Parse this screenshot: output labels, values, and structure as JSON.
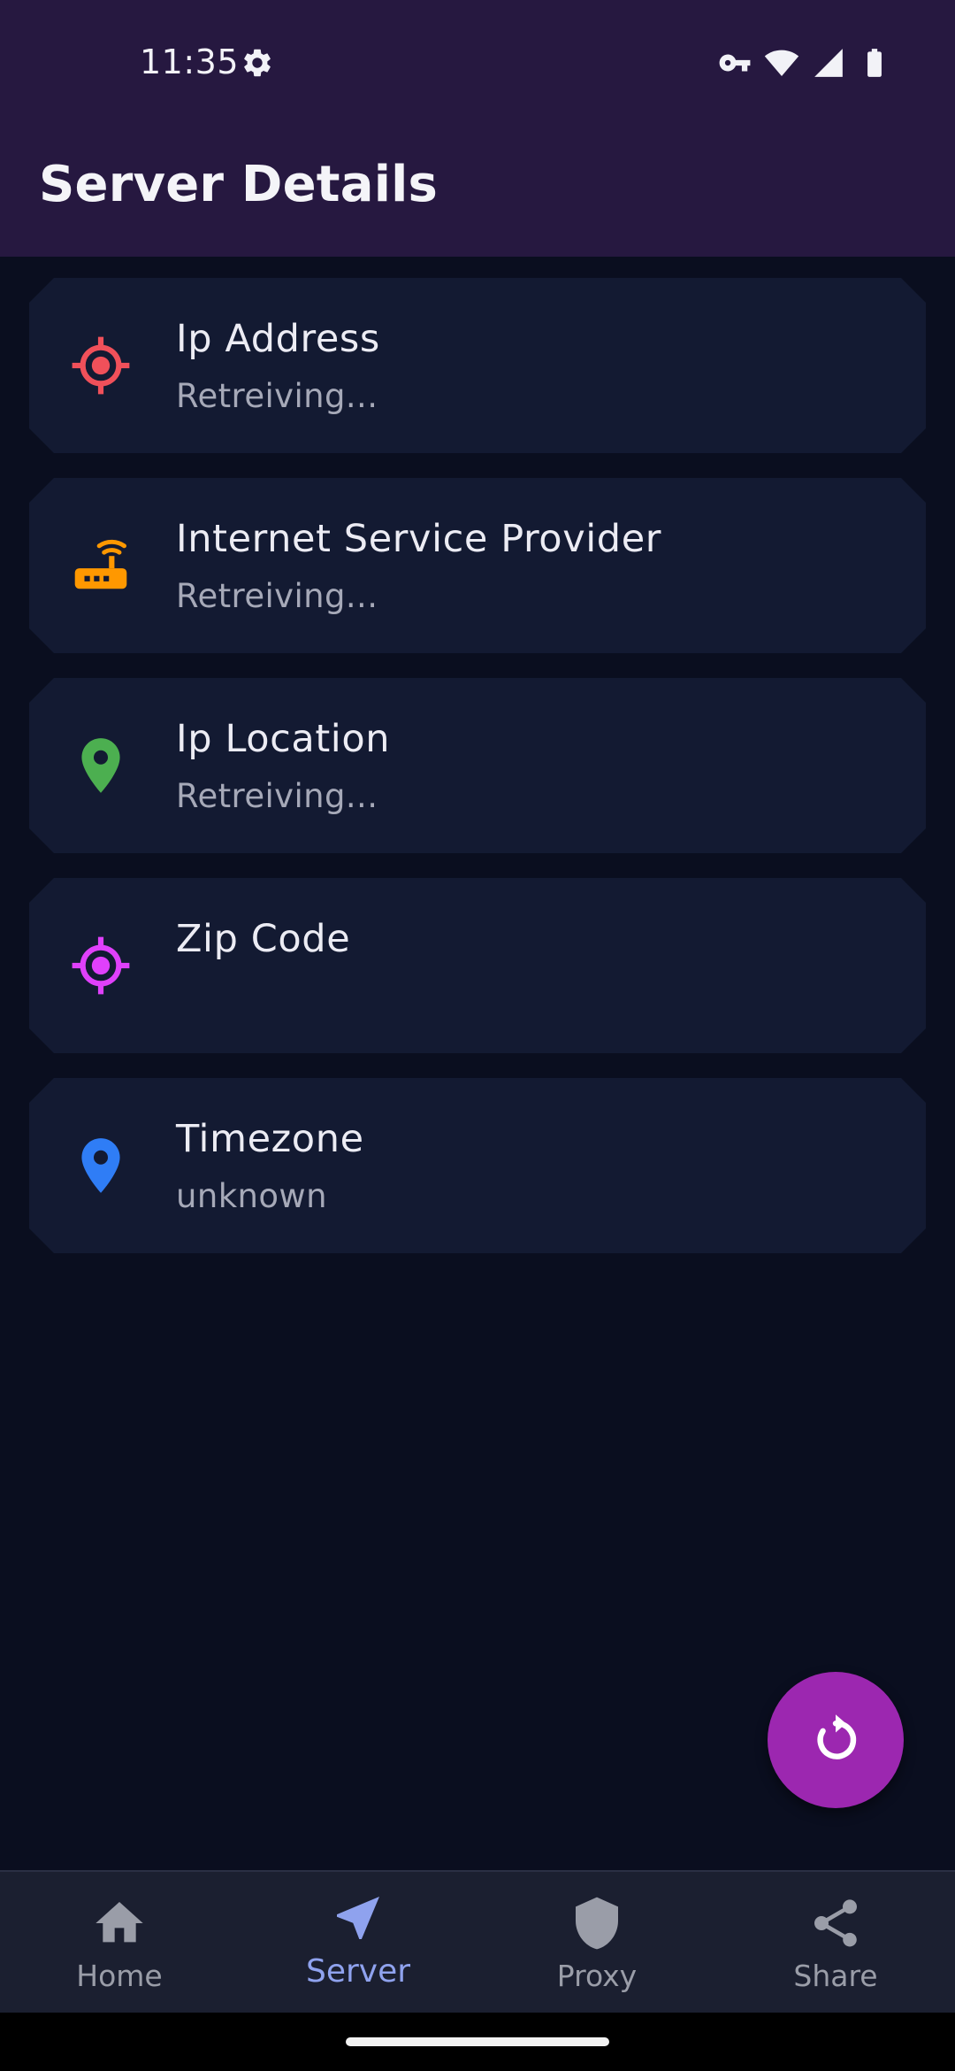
{
  "status_bar": {
    "time": "11:35",
    "icons": [
      "settings-gear-icon",
      "vpn-key-icon",
      "wifi-icon",
      "signal-icon",
      "battery-icon"
    ]
  },
  "app_bar": {
    "title": "Server Details"
  },
  "cards": [
    {
      "title": "Ip Address",
      "value": "Retreiving...",
      "icon": "gps-target-icon",
      "icon_color": "#f0505a"
    },
    {
      "title": "Internet Service Provider",
      "value": "Retreiving...",
      "icon": "router-icon",
      "icon_color": "#ff9800"
    },
    {
      "title": "Ip Location",
      "value": "Retreiving...",
      "icon": "location-pin-icon",
      "icon_color": "#4caf50"
    },
    {
      "title": "Zip Code",
      "value": "",
      "icon": "gps-target-icon",
      "icon_color": "#e040fb"
    },
    {
      "title": "Timezone",
      "value": "unknown",
      "icon": "location-pin-icon",
      "icon_color": "#2f7df6"
    }
  ],
  "fab": {
    "icon": "refresh-icon",
    "color": "#9c27b0"
  },
  "bottom_nav": {
    "items": [
      {
        "label": "Home",
        "icon": "home-icon",
        "active": false
      },
      {
        "label": "Server",
        "icon": "navigation-arrow-icon",
        "active": true
      },
      {
        "label": "Proxy",
        "icon": "shield-icon",
        "active": false
      },
      {
        "label": "Share",
        "icon": "share-icon",
        "active": false
      }
    ],
    "active_color": "#8fa2ee",
    "inactive_color": "#9a9da8"
  }
}
